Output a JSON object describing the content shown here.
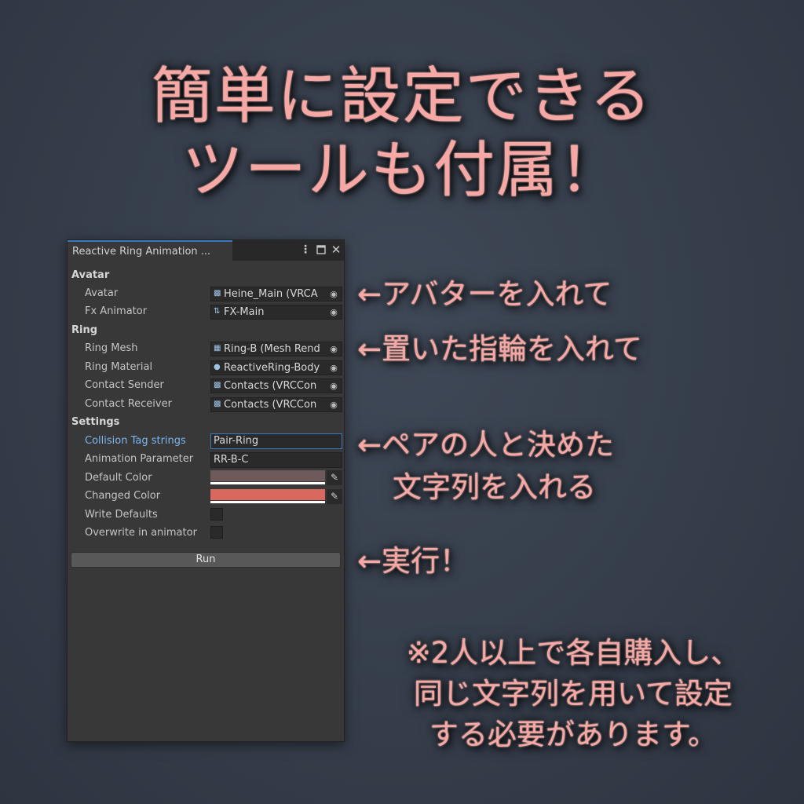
{
  "headline": {
    "line1": "簡単に設定できる",
    "line2": "ツールも付属！"
  },
  "window": {
    "tab_title": "Reactive Ring Animation ...",
    "menu_icon": "kebab-menu-icon",
    "maximize_icon": "maximize-icon",
    "close_icon": "close-icon",
    "sections": {
      "avatar": "Avatar",
      "ring": "Ring",
      "settings": "Settings"
    },
    "fields": {
      "avatar": {
        "label": "Avatar",
        "value": "Heine_Main (VRCA",
        "icon": "script-icon"
      },
      "fx_animator": {
        "label": "Fx Animator",
        "value": "FX-Main",
        "icon": "animator-icon"
      },
      "ring_mesh": {
        "label": "Ring Mesh",
        "value": "Ring-B (Mesh Rend",
        "icon": "mesh-icon"
      },
      "ring_material": {
        "label": "Ring Material",
        "value": "ReactiveRing-Body",
        "icon": "material-icon"
      },
      "contact_sender": {
        "label": "Contact Sender",
        "value": "Contacts (VRCCon",
        "icon": "script-icon"
      },
      "contact_receiver": {
        "label": "Contact Receiver",
        "value": "Contacts (VRCCon",
        "icon": "script-icon"
      },
      "collision_tag": {
        "label": "Collision Tag strings",
        "value": "Pair-Ring"
      },
      "animation_parameter": {
        "label": "Animation Parameter",
        "value": "RR-B-C"
      },
      "default_color": {
        "label": "Default Color",
        "color": "#6e5a5a"
      },
      "changed_color": {
        "label": "Changed Color",
        "color": "#d9695f"
      },
      "write_defaults": {
        "label": "Write Defaults",
        "checked": false
      },
      "overwrite_in_animator": {
        "label": "Overwrite in animator",
        "checked": false
      }
    },
    "run_label": "Run"
  },
  "annotations": {
    "avatar": "←アバターを入れて",
    "ring": "←置いた指輪を入れて",
    "tag_line1": "←ペアの人と決めた",
    "tag_line2": "文字列を入れる",
    "run": "←実行！"
  },
  "note": {
    "line1": "※2人以上で各自購入し、",
    "line2": "同じ文字列を用いて設定",
    "line3": "する必要があります。"
  },
  "colors": {
    "accent": "#3a79bb",
    "glow_text": "#f7a7a4",
    "active_label": "#7ab6f0"
  }
}
